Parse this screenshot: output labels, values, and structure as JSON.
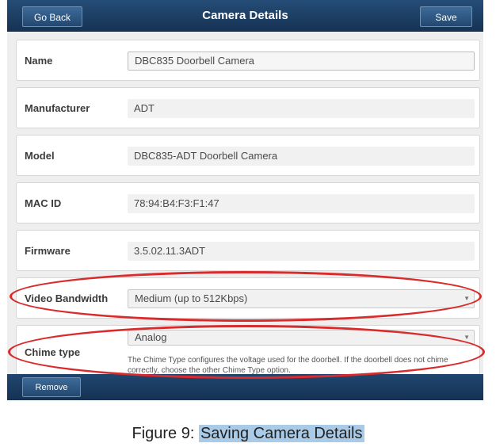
{
  "header": {
    "back_label": "Go Back",
    "title": "Camera Details",
    "save_label": "Save"
  },
  "fields": [
    {
      "label": "Name",
      "value": "DBC835 Doorbell Camera"
    },
    {
      "label": "Manufacturer",
      "value": "ADT"
    },
    {
      "label": "Model",
      "value": "DBC835-ADT Doorbell Camera"
    },
    {
      "label": "MAC ID",
      "value": "78:94:B4:F3:F1:47"
    },
    {
      "label": "Firmware",
      "value": "3.5.02.11.3ADT"
    },
    {
      "label": "Video Bandwidth",
      "value": "Medium (up to 512Kbps)"
    },
    {
      "label": "Chime type",
      "value": "Analog",
      "helper": "The Chime Type configures the voltage used for the doorbell. If the doorbell does not chime correctly, choose the other Chime Type option."
    }
  ],
  "footer": {
    "remove_label": "Remove"
  },
  "caption": {
    "prefix": "Figure 9: ",
    "highlight": "Saving Camera Details"
  },
  "colors": {
    "annotation": "#d92b2b",
    "bar": "#1b3a5c",
    "caption_highlight": "#a9cbe8"
  }
}
